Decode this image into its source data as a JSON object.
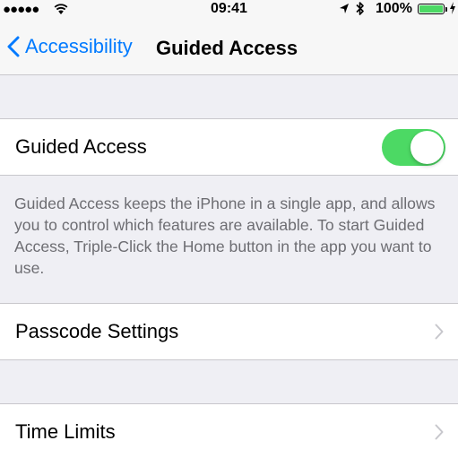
{
  "status_bar": {
    "signal": "●●●●●",
    "time": "09:41",
    "battery_percent": "100%",
    "battery_level": 1.0,
    "battery_color": "#4cd964"
  },
  "nav": {
    "back_label": "Accessibility",
    "title": "Guided Access",
    "accent_color": "#007aff"
  },
  "guided_access": {
    "label": "Guided Access",
    "toggle_on": true,
    "toggle_color": "#4cd964",
    "footer": "Guided Access keeps the iPhone in a single app, and allows you to control which features are available. To start Guided Access, Triple-Click the Home button in the app you want to use."
  },
  "rows": {
    "passcode_settings": "Passcode Settings",
    "time_limits": "Time Limits"
  }
}
